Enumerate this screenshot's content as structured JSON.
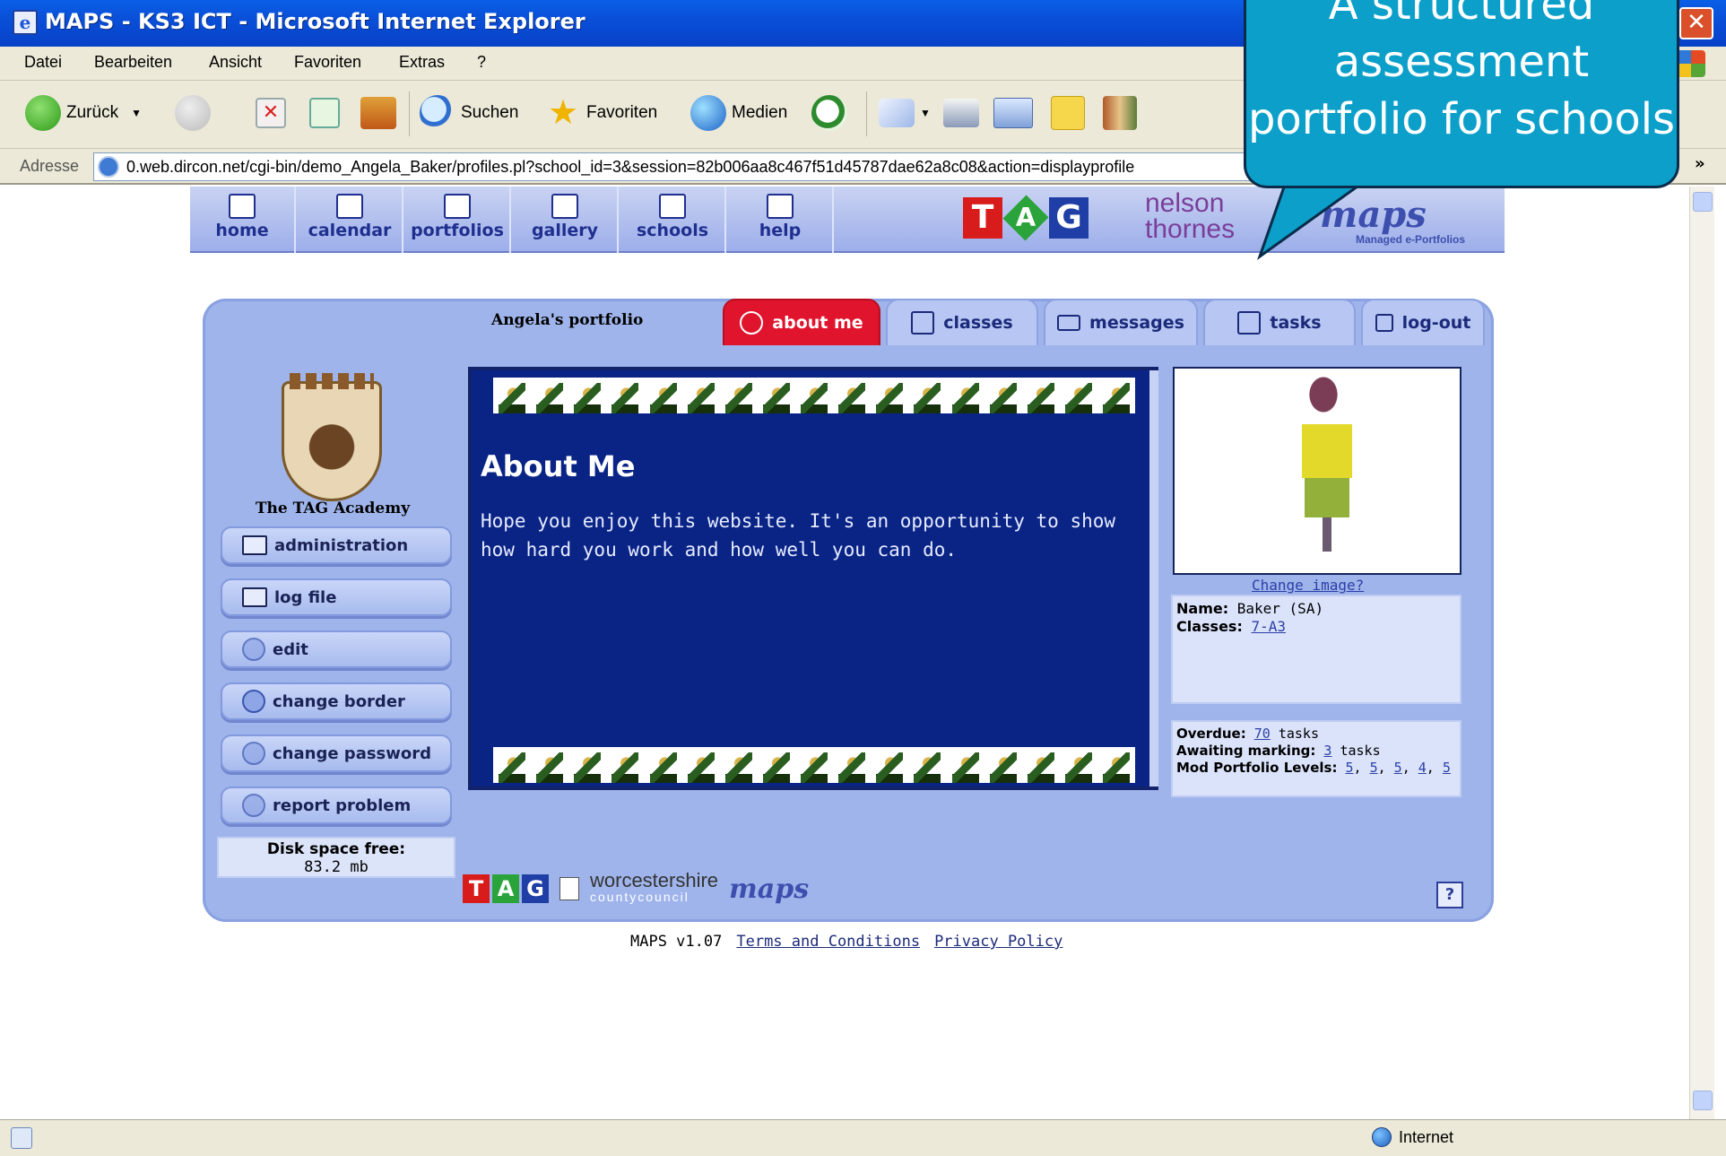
{
  "window": {
    "title": "MAPS - KS3 ICT - Microsoft Internet Explorer",
    "close": "✕"
  },
  "menu": [
    "Datei",
    "Bearbeiten",
    "Ansicht",
    "Favoriten",
    "Extras",
    "?"
  ],
  "toolbar": {
    "back": "Zurück",
    "search": "Suchen",
    "favorites": "Favoriten",
    "media": "Medien"
  },
  "address": {
    "label": "Adresse",
    "url": "0.web.dircon.net/cgi-bin/demo_Angela_Baker/profiles.pl?school_id=3&session=82b006aa8c467f51d45787dae62a8c08&action=displayprofile",
    "more": "»"
  },
  "status": {
    "zone": "Internet"
  },
  "callout": {
    "text": "A structured assessment portfolio for schools"
  },
  "sitenav": {
    "items": [
      {
        "label": "home"
      },
      {
        "label": "calendar"
      },
      {
        "label": "portfolios"
      },
      {
        "label": "gallery"
      },
      {
        "label": "schools"
      },
      {
        "label": "help"
      }
    ],
    "tag_letters": [
      "T",
      "A",
      "G"
    ],
    "nelson": "nelson thornes",
    "maps_logo": "maps",
    "maps_tagline": "Managed e-Portfolios"
  },
  "portfolio": {
    "title": "Angela's portfolio",
    "tabs": [
      {
        "label": "about me",
        "active": true
      },
      {
        "label": "classes",
        "active": false
      },
      {
        "label": "messages",
        "active": false
      },
      {
        "label": "tasks",
        "active": false
      },
      {
        "label": "log-out",
        "active": false
      }
    ],
    "school_name": "The TAG Academy",
    "sidebar_buttons": [
      "administration",
      "log file",
      "edit",
      "change border",
      "change password",
      "report problem"
    ],
    "disk_label": "Disk space free:",
    "disk_value": "83.2 mb",
    "content_title": "About Me",
    "content_text": "Hope you enjoy this website. It's an opportunity to show how hard you work and how well you can do.",
    "change_image": "Change image?",
    "profile": {
      "name_label": "Name:",
      "name_value": "Baker (SA)",
      "classes_label": "Classes:",
      "classes_value": "7-A3"
    },
    "stats": {
      "overdue_label": "Overdue:",
      "overdue_value": "70",
      "overdue_suffix": "tasks",
      "awaiting_label": "Awaiting marking:",
      "awaiting_value": "3",
      "awaiting_suffix": "tasks",
      "levels_label": "Mod Portfolio Levels:",
      "levels": [
        "5",
        "5",
        "5",
        "4",
        "5"
      ]
    },
    "footer_logos": {
      "worcestershire": "worcestershire",
      "countycouncil": "countycouncil"
    }
  },
  "footer": {
    "version": "MAPS v1.07",
    "terms": "Terms and Conditions",
    "privacy": "Privacy Policy"
  }
}
